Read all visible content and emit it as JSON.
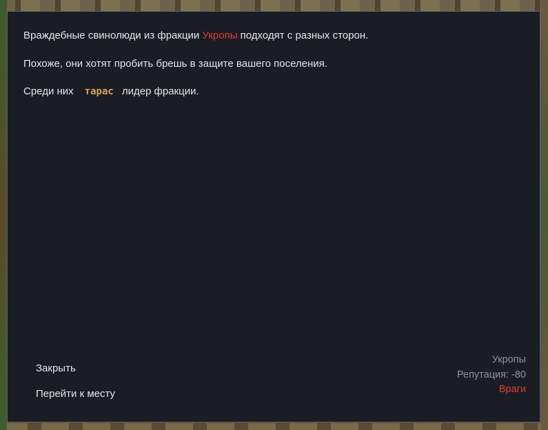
{
  "colors": {
    "dialog_background": "#1a1d23",
    "dialog_border": "#5b6472",
    "text": "#e4e6ea",
    "faction_highlight": "#e03b3b",
    "leader_highlight": "#d8a25a",
    "muted": "#8f949c",
    "status_hostile": "#e03b3b"
  },
  "message": {
    "line1": {
      "before": "Враждебные свинолюди из фракции",
      "faction": "Укропы",
      "after": "подходят с разных сторон."
    },
    "line2": "Похоже, они хотят пробить брешь в защите вашего поселения.",
    "line3": {
      "before": "Среди них",
      "leader": "тарас",
      "after": "лидер фракции."
    }
  },
  "actions": {
    "close_label": "Закрыть",
    "goto_label": "Перейти к месту"
  },
  "faction_info": {
    "name": "Укропы",
    "reputation": "Репутация: -80",
    "status": "Враги"
  }
}
